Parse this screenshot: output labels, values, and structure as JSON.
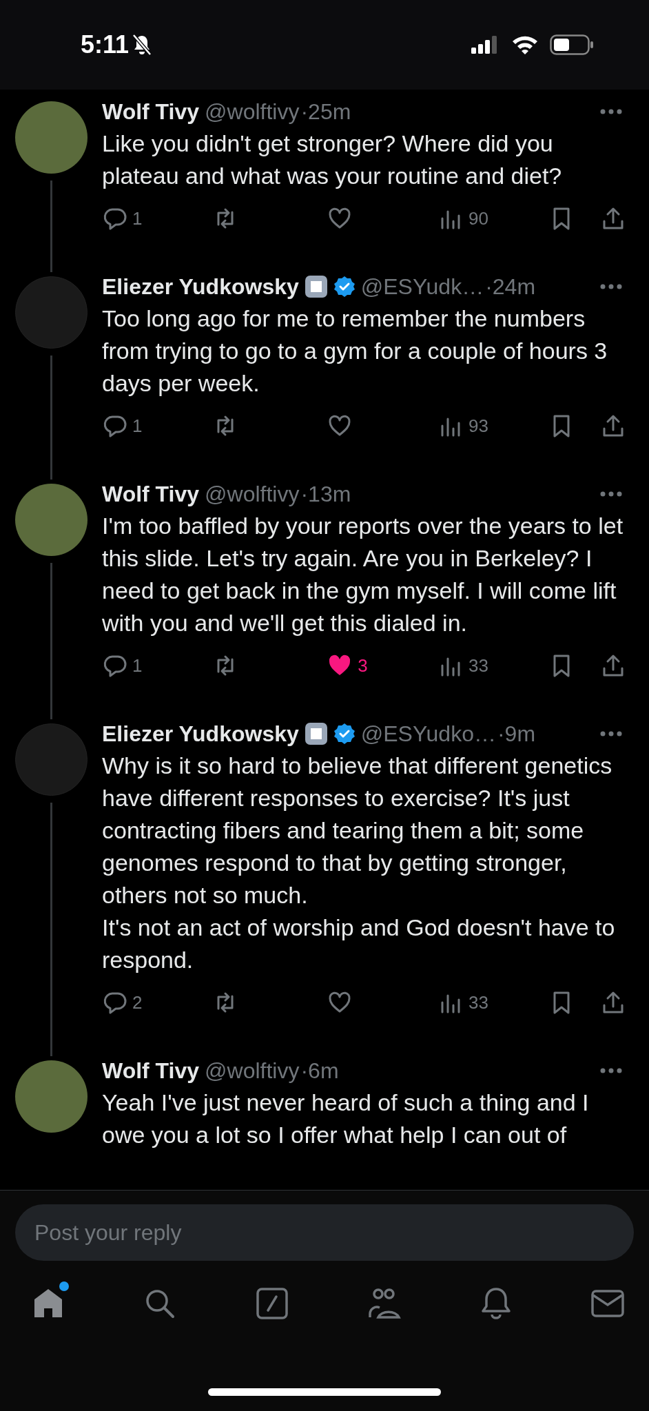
{
  "status_bar": {
    "time": "5:11",
    "muted": true
  },
  "tweets": [
    {
      "name": "Wolf Tivy",
      "label_badge": false,
      "verified": false,
      "handle": "@wolftivy",
      "time": "·25m",
      "text": "Like you didn't get stronger? Where did you plateau and what was your routine and diet?",
      "thread_line": true,
      "actions": {
        "replies": "1",
        "liked": false,
        "views": "90"
      }
    },
    {
      "name": "Eliezer Yudkowsky",
      "label_badge": true,
      "verified": true,
      "handle": "@ESYudk…",
      "time": "·24m",
      "text": "Too long ago for me to remember the numbers from trying to go to a gym for a couple of hours 3 days per week.",
      "thread_line": true,
      "actions": {
        "replies": "1",
        "liked": false,
        "views": "93"
      }
    },
    {
      "name": "Wolf Tivy",
      "label_badge": false,
      "verified": false,
      "handle": "@wolftivy",
      "time": "·13m",
      "text": "I'm too baffled by your reports over the years to let this slide. Let's try again. Are you in Berkeley? I need to get back in the gym myself. I will come lift with you and we'll get this dialed in.",
      "thread_line": true,
      "actions": {
        "replies": "1",
        "liked": true,
        "likes": "3",
        "views": "33"
      }
    },
    {
      "name": "Eliezer Yudkowsky",
      "label_badge": true,
      "verified": true,
      "handle": "@ESYudko…",
      "time": "·9m",
      "text": "Why is it so hard to believe that different genetics have different responses to exercise? It's just contracting fibers and tearing them a bit; some genomes respond to that by getting stronger, others not so much.\nIt's not an act of worship and God doesn't have to respond.",
      "thread_line": true,
      "actions": {
        "replies": "2",
        "liked": false,
        "views": "33"
      }
    },
    {
      "name": "Wolf Tivy",
      "label_badge": false,
      "verified": false,
      "handle": "@wolftivy",
      "time": "·6m",
      "text": "Yeah I've just never heard of such a thing and I owe you a lot so I offer what help I can out of",
      "thread_line": false
    }
  ],
  "reply_field": {
    "placeholder": "Post your reply"
  },
  "nav": [
    {
      "kind": "home",
      "selected": true,
      "badge": true
    },
    {
      "kind": "search",
      "selected": false,
      "badge": false
    },
    {
      "kind": "compose",
      "selected": false,
      "badge": false
    },
    {
      "kind": "communities",
      "selected": false,
      "badge": false
    },
    {
      "kind": "bell",
      "selected": false,
      "badge": false
    },
    {
      "kind": "mail",
      "selected": false,
      "badge": false
    }
  ]
}
